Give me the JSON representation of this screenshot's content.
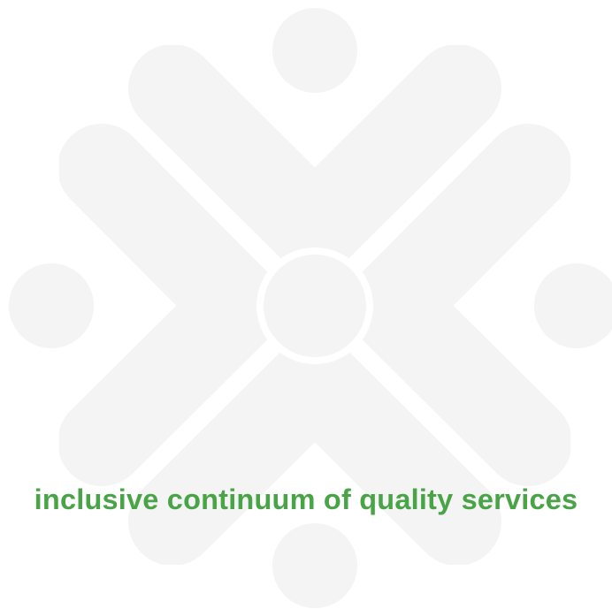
{
  "tagline": {
    "text": "inclusive continuum of quality services",
    "color": "#49a447"
  },
  "watermark": {
    "icon": "people-cross-logo",
    "color": "#f4f4f4"
  }
}
